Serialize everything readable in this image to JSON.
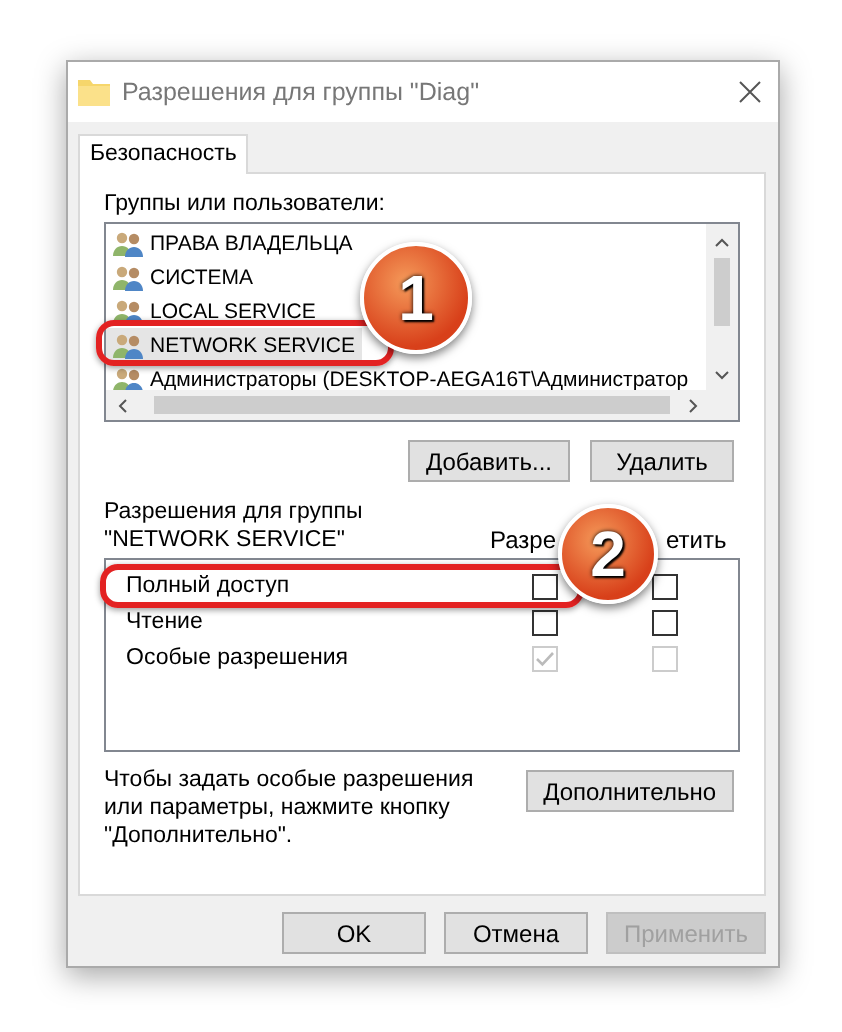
{
  "window": {
    "title": "Разрешения для группы \"Diag\""
  },
  "tabs": [
    {
      "label": "Безопасность",
      "selected": true
    }
  ],
  "groups": {
    "label": "Группы или пользователи:",
    "items": [
      {
        "name": "ПРАВА ВЛАДЕЛЬЦА",
        "selected": false
      },
      {
        "name": "СИСТЕМА",
        "selected": false
      },
      {
        "name": "LOCAL SERVICE",
        "selected": false
      },
      {
        "name": "NETWORK SERVICE",
        "selected": true
      },
      {
        "name": "Администраторы (DESKTOP-AEGA16T\\Администратор",
        "selected": false
      }
    ],
    "buttons": [
      "Добавить...",
      "Удалить"
    ]
  },
  "permissions": {
    "label": "Разрешения для группы \"NETWORK SERVICE\"",
    "columns": [
      "Разре",
      "етить"
    ],
    "rows": [
      {
        "name": "Полный доступ",
        "allow": false,
        "deny": false,
        "disabled": false
      },
      {
        "name": "Чтение",
        "allow": false,
        "deny": false,
        "disabled": false
      },
      {
        "name": "Особые разрешения",
        "allow": true,
        "deny": false,
        "disabled": true
      }
    ]
  },
  "advanced": {
    "note": "Чтобы задать особые разрешения или параметры, нажмите кнопку \"Дополнительно\".",
    "button": "Дополнительно"
  },
  "buttons": [
    {
      "label": "OK",
      "disabled": false
    },
    {
      "label": "Отмена",
      "disabled": false
    },
    {
      "label": "Применить",
      "disabled": true
    }
  ],
  "annotations": [
    {
      "number": "1"
    },
    {
      "number": "2"
    }
  ]
}
